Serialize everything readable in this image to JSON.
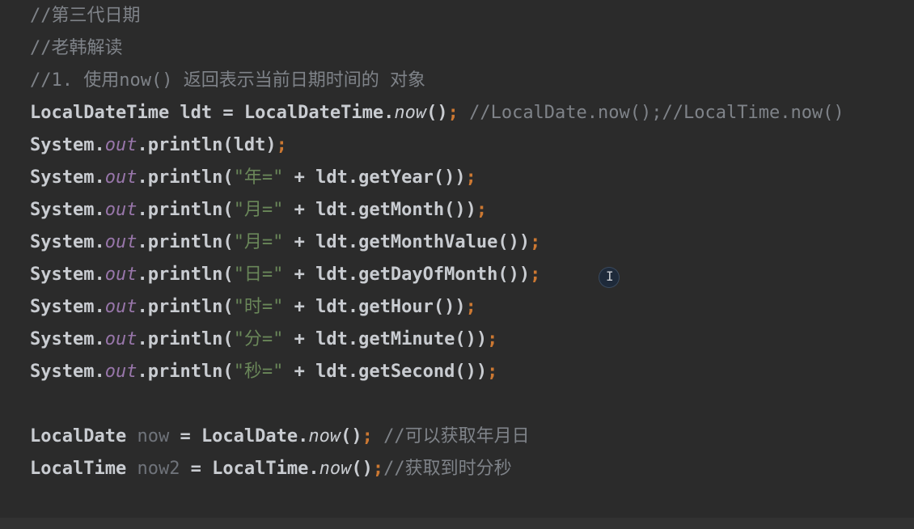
{
  "editor": {
    "lines": [
      {
        "segments": [
          {
            "t": "//第三代日期",
            "c": "comment"
          }
        ]
      },
      {
        "segments": [
          {
            "t": "//老韩解读",
            "c": "comment"
          }
        ]
      },
      {
        "segments": [
          {
            "t": "//1. 使用now() 返回表示当前日期时间的 对象",
            "c": "comment"
          }
        ]
      },
      {
        "segments": [
          {
            "t": "LocalDateTime ldt = LocalDateTime.",
            "c": ""
          },
          {
            "t": "now",
            "c": "italic-method"
          },
          {
            "t": "()",
            "c": ""
          },
          {
            "t": ";",
            "c": "semi"
          },
          {
            "t": " //LocalDate.now();//LocalTime.now()",
            "c": "comment"
          }
        ]
      },
      {
        "segments": [
          {
            "t": "System.",
            "c": ""
          },
          {
            "t": "out",
            "c": "kw-italic-purple"
          },
          {
            "t": ".println(ldt)",
            "c": ""
          },
          {
            "t": ";",
            "c": "semi"
          }
        ]
      },
      {
        "segments": [
          {
            "t": "System.",
            "c": ""
          },
          {
            "t": "out",
            "c": "kw-italic-purple"
          },
          {
            "t": ".println(",
            "c": ""
          },
          {
            "t": "\"年=\"",
            "c": "str"
          },
          {
            "t": " + ldt.getYear())",
            "c": ""
          },
          {
            "t": ";",
            "c": "semi"
          }
        ]
      },
      {
        "segments": [
          {
            "t": "System.",
            "c": ""
          },
          {
            "t": "out",
            "c": "kw-italic-purple"
          },
          {
            "t": ".println(",
            "c": ""
          },
          {
            "t": "\"月=\"",
            "c": "str"
          },
          {
            "t": " + ldt.getMonth())",
            "c": ""
          },
          {
            "t": ";",
            "c": "semi"
          }
        ]
      },
      {
        "segments": [
          {
            "t": "System.",
            "c": ""
          },
          {
            "t": "out",
            "c": "kw-italic-purple"
          },
          {
            "t": ".println(",
            "c": ""
          },
          {
            "t": "\"月=\"",
            "c": "str"
          },
          {
            "t": " + ldt.getMonthValue())",
            "c": ""
          },
          {
            "t": ";",
            "c": "semi"
          }
        ]
      },
      {
        "segments": [
          {
            "t": "System.",
            "c": ""
          },
          {
            "t": "out",
            "c": "kw-italic-purple"
          },
          {
            "t": ".println(",
            "c": ""
          },
          {
            "t": "\"日=\"",
            "c": "str"
          },
          {
            "t": " + ldt.getDayOfMonth())",
            "c": ""
          },
          {
            "t": ";",
            "c": "semi"
          }
        ]
      },
      {
        "segments": [
          {
            "t": "System.",
            "c": ""
          },
          {
            "t": "out",
            "c": "kw-italic-purple"
          },
          {
            "t": ".println(",
            "c": ""
          },
          {
            "t": "\"时=\"",
            "c": "str"
          },
          {
            "t": " + ldt.getHour())",
            "c": ""
          },
          {
            "t": ";",
            "c": "semi"
          }
        ]
      },
      {
        "segments": [
          {
            "t": "System.",
            "c": ""
          },
          {
            "t": "out",
            "c": "kw-italic-purple"
          },
          {
            "t": ".println(",
            "c": ""
          },
          {
            "t": "\"分=\"",
            "c": "str"
          },
          {
            "t": " + ldt.getMinute())",
            "c": ""
          },
          {
            "t": ";",
            "c": "semi"
          }
        ]
      },
      {
        "segments": [
          {
            "t": "System.",
            "c": ""
          },
          {
            "t": "out",
            "c": "kw-italic-purple"
          },
          {
            "t": ".println(",
            "c": ""
          },
          {
            "t": "\"秒=\"",
            "c": "str"
          },
          {
            "t": " + ldt.getSecond())",
            "c": ""
          },
          {
            "t": ";",
            "c": "semi"
          }
        ]
      },
      {
        "segments": []
      },
      {
        "segments": [
          {
            "t": "LocalDate ",
            "c": ""
          },
          {
            "t": "now",
            "c": "unused"
          },
          {
            "t": " = LocalDate.",
            "c": ""
          },
          {
            "t": "now",
            "c": "italic-method"
          },
          {
            "t": "()",
            "c": ""
          },
          {
            "t": ";",
            "c": "semi"
          },
          {
            "t": " //可以获取年月日",
            "c": "comment"
          }
        ]
      },
      {
        "segments": [
          {
            "t": "LocalTime ",
            "c": ""
          },
          {
            "t": "now2",
            "c": "unused"
          },
          {
            "t": " = LocalTime.",
            "c": ""
          },
          {
            "t": "now",
            "c": "italic-method"
          },
          {
            "t": "()",
            "c": ""
          },
          {
            "t": ";",
            "c": "semi"
          },
          {
            "t": "//获取到时分秒",
            "c": "comment"
          }
        ]
      }
    ]
  },
  "colors": {
    "background": "#2b2b2b",
    "default_text": "#c9ccd1",
    "comment": "#7f8389",
    "static_field": "#9876aa",
    "string": "#6a8759",
    "semicolon": "#cc7832"
  },
  "cursor": {
    "icon": "text-cursor-icon"
  }
}
